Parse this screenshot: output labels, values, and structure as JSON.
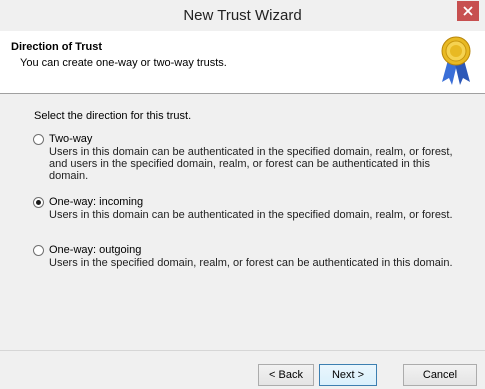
{
  "window": {
    "title": "New Trust Wizard"
  },
  "header": {
    "title": "Direction of Trust",
    "subtitle": "You can create one-way or two-way trusts."
  },
  "prompt": "Select the direction for this trust.",
  "options": [
    {
      "label": "Two-way",
      "selected": false,
      "description": "Users in this domain can be authenticated in the specified domain, realm, or forest, and users in the specified domain, realm, or forest can be authenticated in this domain."
    },
    {
      "label": "One-way: incoming",
      "selected": true,
      "description": "Users in this domain can be authenticated in the specified domain, realm, or forest."
    },
    {
      "label": "One-way: outgoing",
      "selected": false,
      "description": "Users in the specified domain, realm, or forest can be authenticated in this domain."
    }
  ],
  "buttons": {
    "back": "< Back",
    "next": "Next >",
    "cancel": "Cancel"
  },
  "icons": {
    "close": "close-icon",
    "seal": "certificate-seal-icon"
  },
  "colors": {
    "close": "#c75050",
    "seal_gold": "#e8b923",
    "ribbon": "#3a6fd8"
  }
}
